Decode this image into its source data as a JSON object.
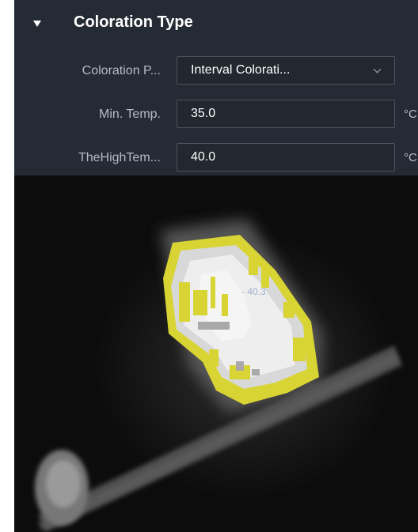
{
  "section": {
    "title": "Coloration Type"
  },
  "fields": {
    "palette": {
      "label": "Coloration P...",
      "value": "Interval Colorati..."
    },
    "min_temp": {
      "label": "Min. Temp.",
      "value": "35.0",
      "unit": "°C"
    },
    "high_temp": {
      "label": "TheHighTem...",
      "value": "40.0",
      "unit": "°C"
    }
  },
  "thermal_view": {
    "marker": "- 40.3"
  },
  "colors": {
    "panel_bg": "#252b34",
    "highlight": "#d8d433"
  }
}
